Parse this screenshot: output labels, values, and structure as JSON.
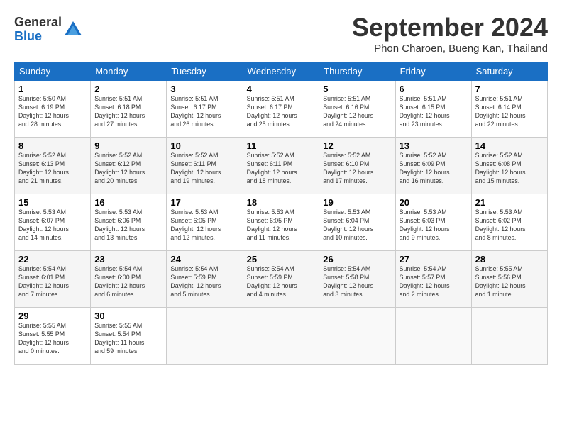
{
  "header": {
    "logo_general": "General",
    "logo_blue": "Blue",
    "title": "September 2024",
    "location": "Phon Charoen, Bueng Kan, Thailand"
  },
  "columns": [
    "Sunday",
    "Monday",
    "Tuesday",
    "Wednesday",
    "Thursday",
    "Friday",
    "Saturday"
  ],
  "weeks": [
    [
      {
        "day": "1",
        "info": "Sunrise: 5:50 AM\nSunset: 6:19 PM\nDaylight: 12 hours\nand 28 minutes."
      },
      {
        "day": "2",
        "info": "Sunrise: 5:51 AM\nSunset: 6:18 PM\nDaylight: 12 hours\nand 27 minutes."
      },
      {
        "day": "3",
        "info": "Sunrise: 5:51 AM\nSunset: 6:17 PM\nDaylight: 12 hours\nand 26 minutes."
      },
      {
        "day": "4",
        "info": "Sunrise: 5:51 AM\nSunset: 6:17 PM\nDaylight: 12 hours\nand 25 minutes."
      },
      {
        "day": "5",
        "info": "Sunrise: 5:51 AM\nSunset: 6:16 PM\nDaylight: 12 hours\nand 24 minutes."
      },
      {
        "day": "6",
        "info": "Sunrise: 5:51 AM\nSunset: 6:15 PM\nDaylight: 12 hours\nand 23 minutes."
      },
      {
        "day": "7",
        "info": "Sunrise: 5:51 AM\nSunset: 6:14 PM\nDaylight: 12 hours\nand 22 minutes."
      }
    ],
    [
      {
        "day": "8",
        "info": "Sunrise: 5:52 AM\nSunset: 6:13 PM\nDaylight: 12 hours\nand 21 minutes."
      },
      {
        "day": "9",
        "info": "Sunrise: 5:52 AM\nSunset: 6:12 PM\nDaylight: 12 hours\nand 20 minutes."
      },
      {
        "day": "10",
        "info": "Sunrise: 5:52 AM\nSunset: 6:11 PM\nDaylight: 12 hours\nand 19 minutes."
      },
      {
        "day": "11",
        "info": "Sunrise: 5:52 AM\nSunset: 6:11 PM\nDaylight: 12 hours\nand 18 minutes."
      },
      {
        "day": "12",
        "info": "Sunrise: 5:52 AM\nSunset: 6:10 PM\nDaylight: 12 hours\nand 17 minutes."
      },
      {
        "day": "13",
        "info": "Sunrise: 5:52 AM\nSunset: 6:09 PM\nDaylight: 12 hours\nand 16 minutes."
      },
      {
        "day": "14",
        "info": "Sunrise: 5:52 AM\nSunset: 6:08 PM\nDaylight: 12 hours\nand 15 minutes."
      }
    ],
    [
      {
        "day": "15",
        "info": "Sunrise: 5:53 AM\nSunset: 6:07 PM\nDaylight: 12 hours\nand 14 minutes."
      },
      {
        "day": "16",
        "info": "Sunrise: 5:53 AM\nSunset: 6:06 PM\nDaylight: 12 hours\nand 13 minutes."
      },
      {
        "day": "17",
        "info": "Sunrise: 5:53 AM\nSunset: 6:05 PM\nDaylight: 12 hours\nand 12 minutes."
      },
      {
        "day": "18",
        "info": "Sunrise: 5:53 AM\nSunset: 6:05 PM\nDaylight: 12 hours\nand 11 minutes."
      },
      {
        "day": "19",
        "info": "Sunrise: 5:53 AM\nSunset: 6:04 PM\nDaylight: 12 hours\nand 10 minutes."
      },
      {
        "day": "20",
        "info": "Sunrise: 5:53 AM\nSunset: 6:03 PM\nDaylight: 12 hours\nand 9 minutes."
      },
      {
        "day": "21",
        "info": "Sunrise: 5:53 AM\nSunset: 6:02 PM\nDaylight: 12 hours\nand 8 minutes."
      }
    ],
    [
      {
        "day": "22",
        "info": "Sunrise: 5:54 AM\nSunset: 6:01 PM\nDaylight: 12 hours\nand 7 minutes."
      },
      {
        "day": "23",
        "info": "Sunrise: 5:54 AM\nSunset: 6:00 PM\nDaylight: 12 hours\nand 6 minutes."
      },
      {
        "day": "24",
        "info": "Sunrise: 5:54 AM\nSunset: 5:59 PM\nDaylight: 12 hours\nand 5 minutes."
      },
      {
        "day": "25",
        "info": "Sunrise: 5:54 AM\nSunset: 5:59 PM\nDaylight: 12 hours\nand 4 minutes."
      },
      {
        "day": "26",
        "info": "Sunrise: 5:54 AM\nSunset: 5:58 PM\nDaylight: 12 hours\nand 3 minutes."
      },
      {
        "day": "27",
        "info": "Sunrise: 5:54 AM\nSunset: 5:57 PM\nDaylight: 12 hours\nand 2 minutes."
      },
      {
        "day": "28",
        "info": "Sunrise: 5:55 AM\nSunset: 5:56 PM\nDaylight: 12 hours\nand 1 minute."
      }
    ],
    [
      {
        "day": "29",
        "info": "Sunrise: 5:55 AM\nSunset: 5:55 PM\nDaylight: 12 hours\nand 0 minutes."
      },
      {
        "day": "30",
        "info": "Sunrise: 5:55 AM\nSunset: 5:54 PM\nDaylight: 11 hours\nand 59 minutes."
      },
      {
        "day": "",
        "info": ""
      },
      {
        "day": "",
        "info": ""
      },
      {
        "day": "",
        "info": ""
      },
      {
        "day": "",
        "info": ""
      },
      {
        "day": "",
        "info": ""
      }
    ]
  ]
}
